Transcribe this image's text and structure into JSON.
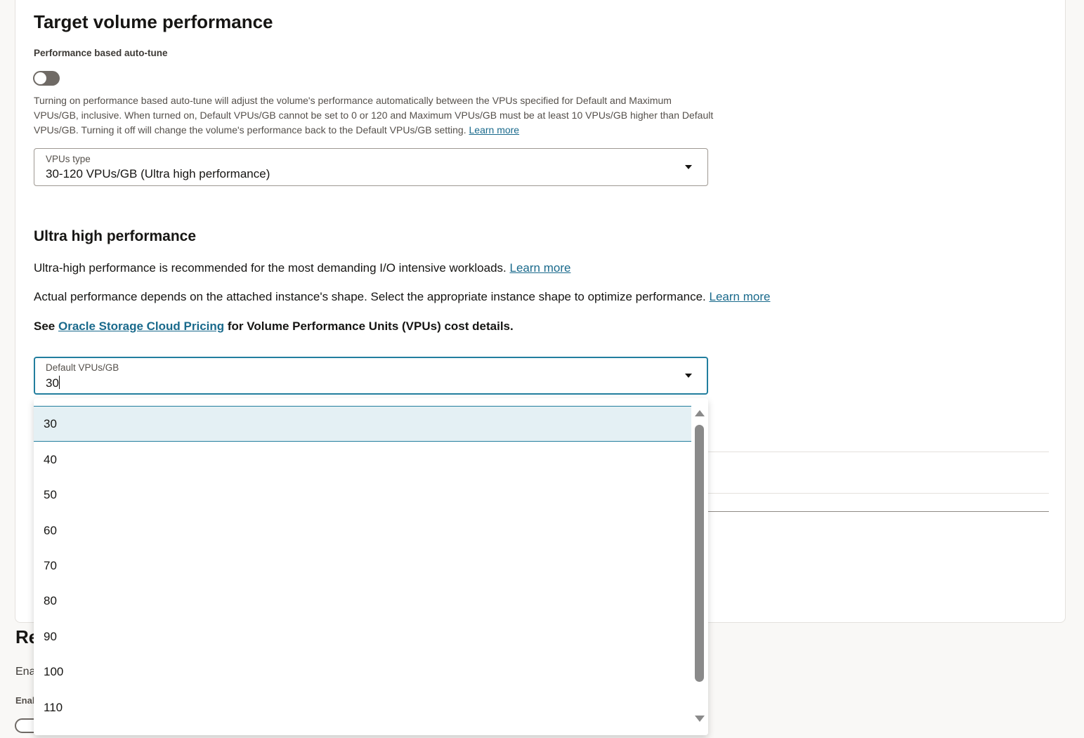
{
  "section": {
    "title": "Target volume performance",
    "autotune_label": "Performance based auto-tune",
    "autotune_on": false,
    "autotune_help": "Turning on performance based auto-tune will adjust the volume's performance automatically between the VPUs specified for Default and Maximum VPUs/GB, inclusive. When turned on, Default VPUs/GB cannot be set to 0 or 120 and Maximum VPUs/GB must be at least 10 VPUs/GB higher than Default VPUs/GB. Turning it off will change the volume's performance back to the Default VPUs/GB setting.",
    "learn_more": "Learn more"
  },
  "vpus_type": {
    "label": "VPUs type",
    "value": "30-120 VPUs/GB (Ultra high performance)"
  },
  "ultra": {
    "title": "Ultra high performance",
    "line1": "Ultra-high performance is recommended for the most demanding I/O intensive workloads.",
    "line2": "Actual performance depends on the attached instance's shape. Select the appropriate instance shape to optimize performance.",
    "learn_more": "Learn more",
    "pricing_prefix": "See",
    "pricing_link": "Oracle Storage Cloud Pricing",
    "pricing_suffix": "for Volume Performance Units (VPUs) cost details."
  },
  "default_vpus": {
    "label": "Default VPUs/GB",
    "value": "30",
    "options": [
      "30",
      "40",
      "50",
      "60",
      "70",
      "80",
      "90",
      "100",
      "110"
    ],
    "selected": "30"
  },
  "below": {
    "heading": "Re",
    "text1": "Ena",
    "text2": "Enal"
  },
  "colors": {
    "accent": "#227e9e",
    "link": "#1a6a8c",
    "highlight": "#e4f0f4"
  }
}
